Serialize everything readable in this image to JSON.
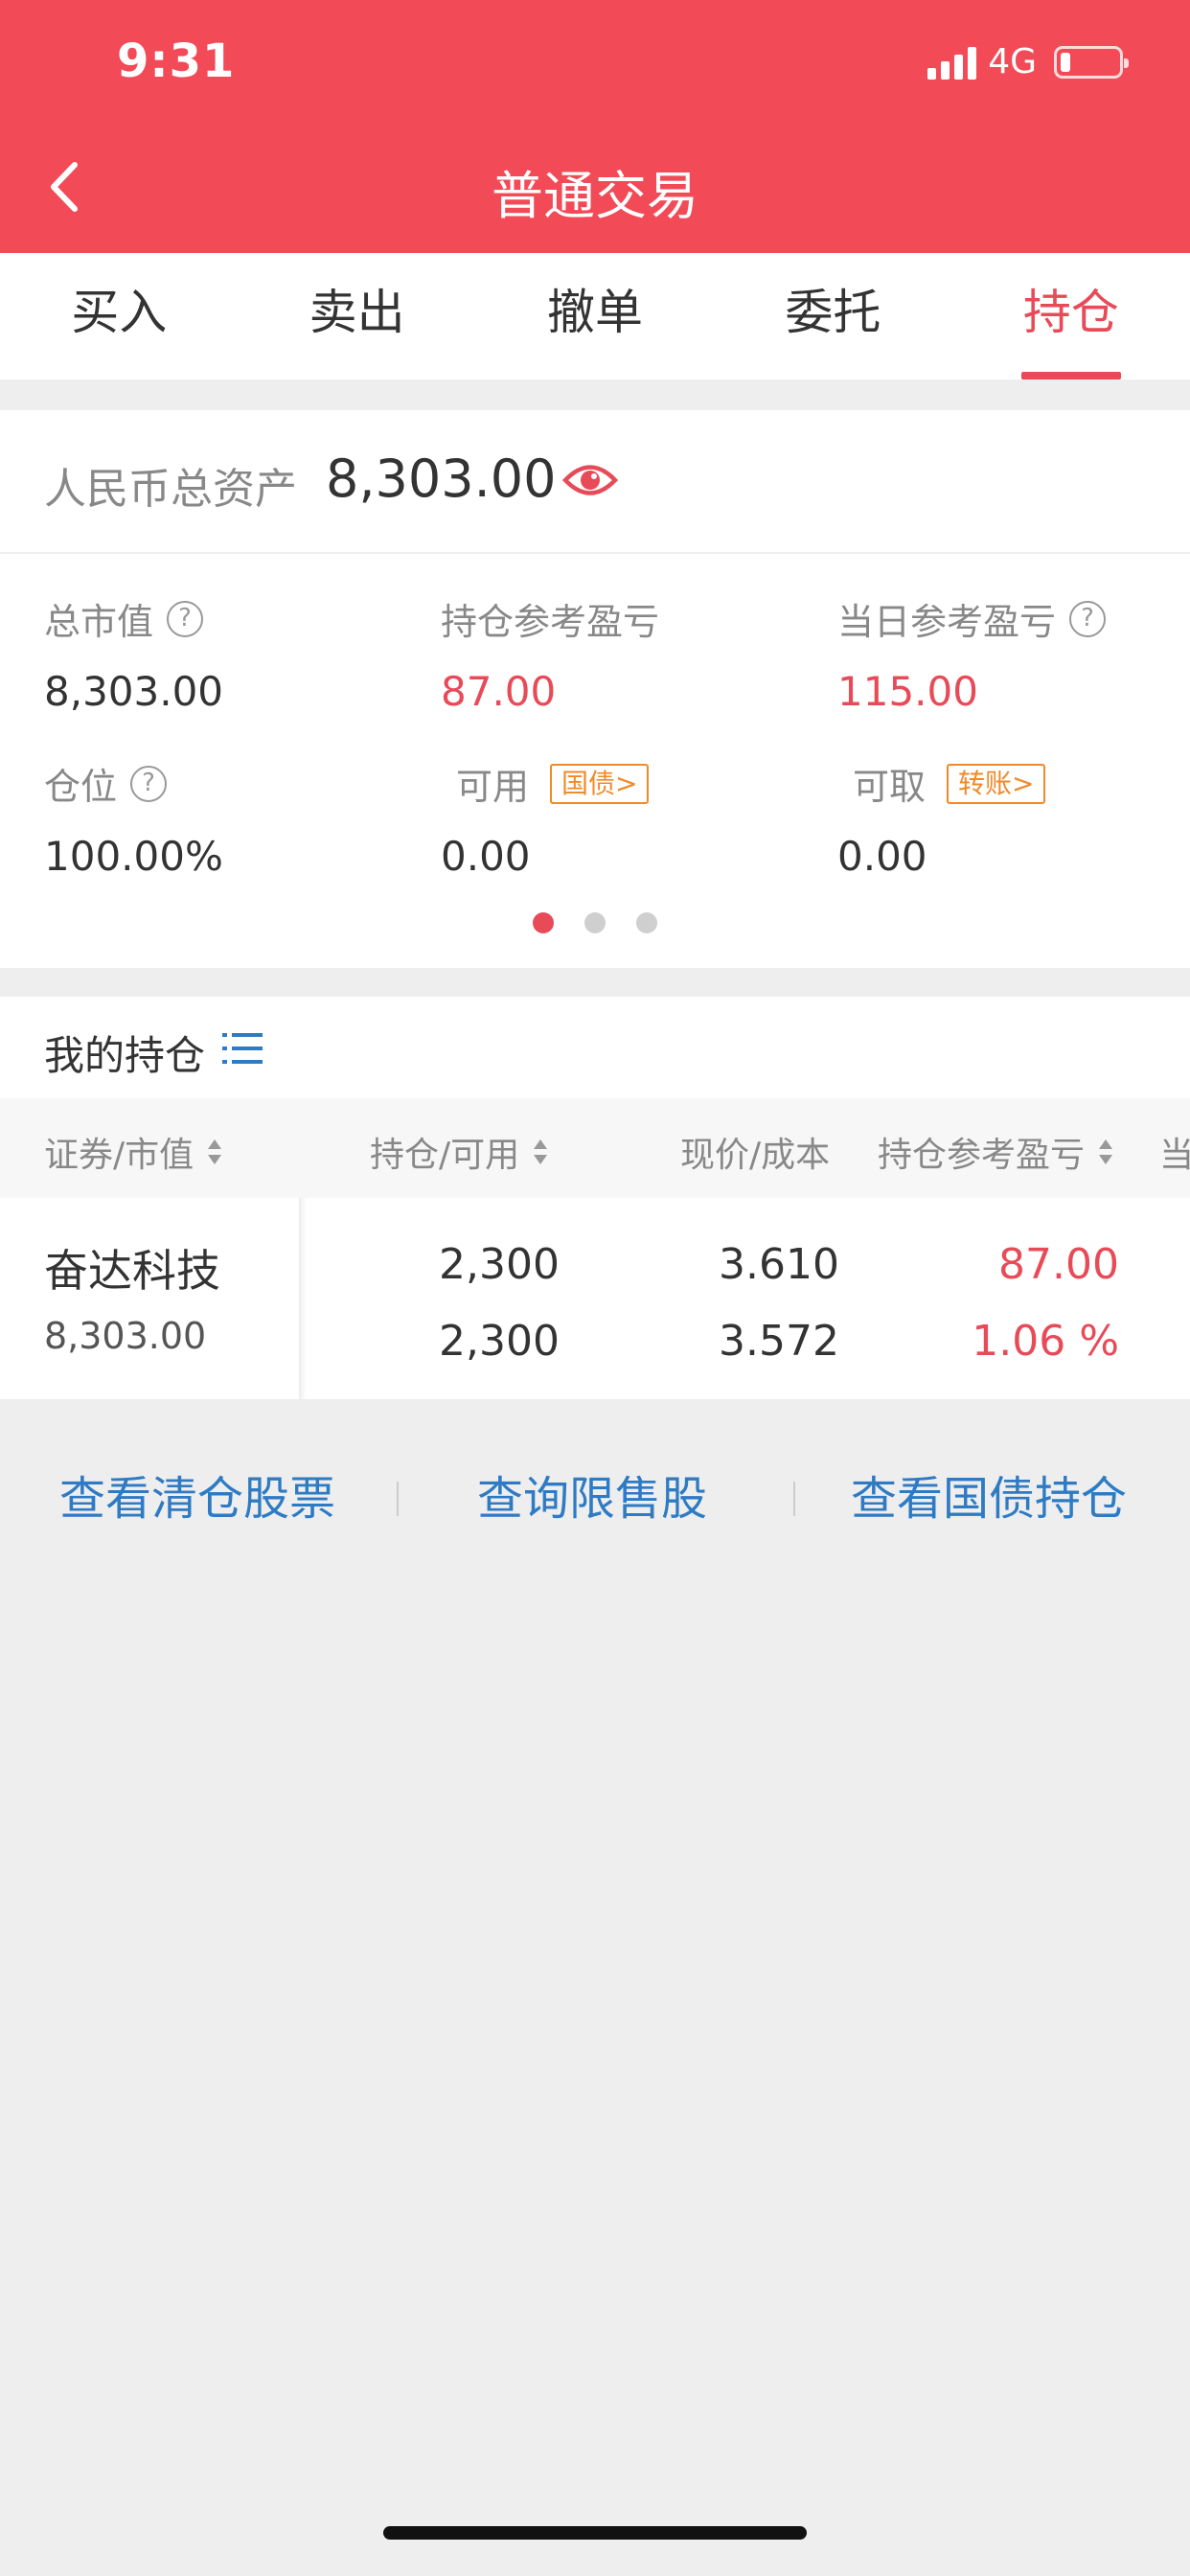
{
  "status": {
    "time": "9:31",
    "network": "4G"
  },
  "header": {
    "title": "普通交易"
  },
  "tabs": [
    {
      "label": "买入",
      "active": false
    },
    {
      "label": "卖出",
      "active": false
    },
    {
      "label": "撤单",
      "active": false
    },
    {
      "label": "委托",
      "active": false
    },
    {
      "label": "持仓",
      "active": true
    }
  ],
  "assets": {
    "total_label": "人民币总资产",
    "total_value": "8,303.00",
    "stats": {
      "market_value": {
        "label": "总市值",
        "value": "8,303.00"
      },
      "position_pnl": {
        "label": "持仓参考盈亏",
        "value": "87.00"
      },
      "daily_pnl": {
        "label": "当日参考盈亏",
        "value": "115.00"
      },
      "position_ratio": {
        "label": "仓位",
        "value": "100.00%"
      },
      "available": {
        "label": "可用",
        "tag": "国债>",
        "value": "0.00"
      },
      "withdrawable": {
        "label": "可取",
        "tag": "转账>",
        "value": "0.00"
      }
    },
    "page_dots": {
      "count": 3,
      "active_index": 0
    }
  },
  "holdings": {
    "title": "我的持仓",
    "columns": [
      "证券/市值",
      "持仓/可用",
      "现价/成本",
      "持仓参考盈亏",
      "当"
    ],
    "rows": [
      {
        "name": "奋达科技",
        "market_value": "8,303.00",
        "position": "2,300",
        "available": "2,300",
        "price": "3.610",
        "cost": "3.572",
        "pnl": "87.00",
        "pnl_pct": "1.06 %"
      }
    ]
  },
  "links": [
    "查看清仓股票",
    "查询限售股",
    "查看国债持仓"
  ],
  "colors": {
    "brand": "#F24A57",
    "accent": "#E84A58",
    "link": "#2E7BC4",
    "tag": "#F08A2A"
  },
  "icons": {
    "back": "chevron-left-icon",
    "eye": "eye-icon",
    "help": "question-circle-icon",
    "list": "list-icon",
    "sort": "sort-icon"
  }
}
